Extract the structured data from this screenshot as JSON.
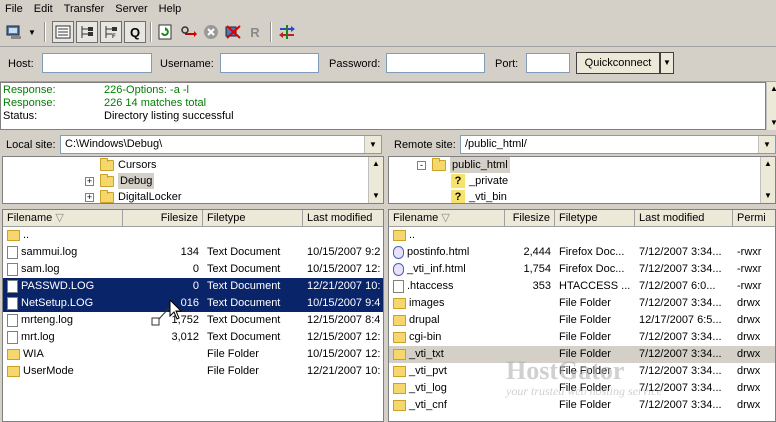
{
  "menu": [
    "File",
    "Edit",
    "Transfer",
    "Server",
    "Help"
  ],
  "toolbar": {
    "icons": [
      "site-manager-icon",
      "dropdown-arrow-icon",
      "message-log-toggle-icon",
      "local-tree-toggle-icon",
      "remote-tree-toggle-icon",
      "transfer-queue-icon",
      "refresh-icon",
      "process-queue-icon",
      "cancel-icon",
      "disconnect-icon",
      "reconnect-icon",
      "compare-icon"
    ],
    "queue_glyph": "Q",
    "reconnect_glyph": "R"
  },
  "quickconnect": {
    "host_label": "Host:",
    "username_label": "Username:",
    "password_label": "Password:",
    "port_label": "Port:",
    "host_value": "",
    "username_value": "",
    "password_value": "",
    "port_value": "",
    "button_label": "Quickconnect"
  },
  "log": [
    {
      "label": "Response:",
      "text": "226-Options: -a -l",
      "color": "#008000"
    },
    {
      "label": "Response:",
      "text": "226 14 matches total",
      "color": "#008000"
    },
    {
      "label": "Status:",
      "text": "Directory listing successful",
      "color": "#000000"
    }
  ],
  "local": {
    "site_label": "Local site:",
    "path": "C:\\Windows\\Debug\\",
    "tree": [
      {
        "name": "Cursors",
        "expander": ""
      },
      {
        "name": "Debug",
        "expander": "+"
      },
      {
        "name": "DigitalLocker",
        "expander": "+"
      }
    ],
    "columns": [
      "Filename",
      "Filesize",
      "Filetype",
      "Last modified"
    ],
    "files": [
      {
        "name": "..",
        "size": "",
        "type": "",
        "modified": "",
        "kind": "folder"
      },
      {
        "name": "sammui.log",
        "size": "134",
        "type": "Text Document",
        "modified": "10/15/2007 9:2",
        "kind": "file"
      },
      {
        "name": "sam.log",
        "size": "0",
        "type": "Text Document",
        "modified": "10/15/2007 12:",
        "kind": "file"
      },
      {
        "name": "PASSWD.LOG",
        "size": "0",
        "type": "Text Document",
        "modified": "12/21/2007 10:",
        "kind": "file"
      },
      {
        "name": "NetSetup.LOG",
        "size": "016",
        "type": "Text Document",
        "modified": "10/15/2007 9:4",
        "kind": "file"
      },
      {
        "name": "mrteng.log",
        "size": "1,752",
        "type": "Text Document",
        "modified": "12/15/2007 8:4",
        "kind": "file"
      },
      {
        "name": "mrt.log",
        "size": "3,012",
        "type": "Text Document",
        "modified": "12/15/2007 12:",
        "kind": "file"
      },
      {
        "name": "WIA",
        "size": "",
        "type": "File Folder",
        "modified": "10/15/2007 12:",
        "kind": "folder"
      },
      {
        "name": "UserMode",
        "size": "",
        "type": "File Folder",
        "modified": "12/21/2007 10:",
        "kind": "folder"
      }
    ]
  },
  "remote": {
    "site_label": "Remote site:",
    "path": "/public_html/",
    "tree": [
      {
        "name": "public_html",
        "expander": "-"
      },
      {
        "name": "_private",
        "expander": ""
      },
      {
        "name": "_vti_bin",
        "expander": ""
      }
    ],
    "columns": [
      "Filename",
      "Filesize",
      "Filetype",
      "Last modified",
      "Permi"
    ],
    "files": [
      {
        "name": "..",
        "size": "",
        "type": "",
        "modified": "",
        "perm": "",
        "kind": "folder"
      },
      {
        "name": "postinfo.html",
        "size": "2,444",
        "type": "Firefox Doc...",
        "modified": "7/12/2007 3:34...",
        "perm": "-rwxr",
        "kind": "ff"
      },
      {
        "name": "_vti_inf.html",
        "size": "1,754",
        "type": "Firefox Doc...",
        "modified": "7/12/2007 3:34...",
        "perm": "-rwxr",
        "kind": "ff"
      },
      {
        "name": ".htaccess",
        "size": "353",
        "type": "HTACCESS ...",
        "modified": "7/12/2007 6:0...",
        "perm": "-rwxr",
        "kind": "file"
      },
      {
        "name": "images",
        "size": "",
        "type": "File Folder",
        "modified": "7/12/2007 3:34...",
        "perm": "drwx",
        "kind": "folder"
      },
      {
        "name": "drupal",
        "size": "",
        "type": "File Folder",
        "modified": "12/17/2007 6:5...",
        "perm": "drwx",
        "kind": "folder"
      },
      {
        "name": "cgi-bin",
        "size": "",
        "type": "File Folder",
        "modified": "7/12/2007 3:34...",
        "perm": "drwx",
        "kind": "folder"
      },
      {
        "name": "_vti_txt",
        "size": "",
        "type": "File Folder",
        "modified": "7/12/2007 3:34...",
        "perm": "drwx",
        "kind": "folder"
      },
      {
        "name": "_vti_pvt",
        "size": "",
        "type": "File Folder",
        "modified": "7/12/2007 3:34...",
        "perm": "drwx",
        "kind": "folder"
      },
      {
        "name": "_vti_log",
        "size": "",
        "type": "File Folder",
        "modified": "7/12/2007 3:34...",
        "perm": "drwx",
        "kind": "folder"
      },
      {
        "name": "_vti_cnf",
        "size": "",
        "type": "File Folder",
        "modified": "7/12/2007 3:34...",
        "perm": "drwx",
        "kind": "folder"
      }
    ]
  },
  "watermark": {
    "line1": "HostGator",
    "line2": "your trusted web hosting service"
  },
  "colors": {
    "selection": "#0a246a",
    "response": "#008000",
    "folder": "#f5d76e",
    "chrome": "#d4d0c8"
  }
}
